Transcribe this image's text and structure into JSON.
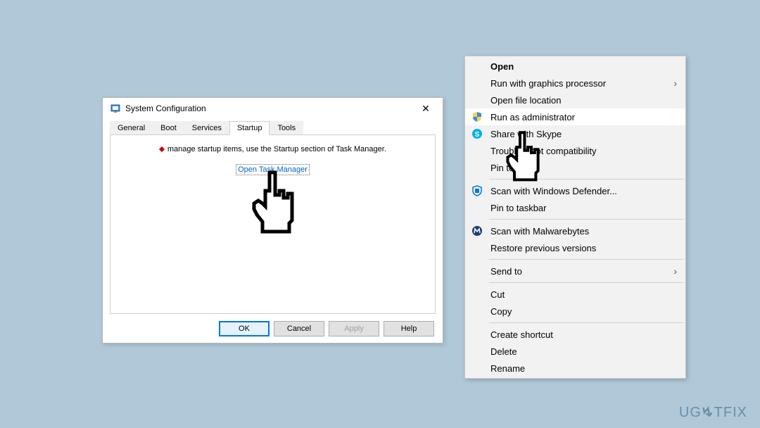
{
  "dialog": {
    "title": "System Configuration",
    "tabs": [
      "General",
      "Boot",
      "Services",
      "Startup",
      "Tools"
    ],
    "active_tab_index": 3,
    "hint": "manage startup items, use the Startup section of Task Manager.",
    "link_label": "Open Task Manager",
    "buttons": {
      "ok": "OK",
      "cancel": "Cancel",
      "apply": "Apply",
      "help": "Help"
    }
  },
  "context_menu": {
    "items": [
      {
        "label": "Open",
        "bold": true
      },
      {
        "label": "Run with graphics processor",
        "submenu": true
      },
      {
        "label": "Open file location"
      },
      {
        "label": "Run as administrator",
        "icon": "shield",
        "highlight": true
      },
      {
        "label": "Share with Skype",
        "icon": "skype"
      },
      {
        "label": "Troubleshoot compatibility"
      },
      {
        "label": "Pin to Start"
      },
      {
        "sep": true
      },
      {
        "label": "Scan with Windows Defender...",
        "icon": "defender"
      },
      {
        "label": "Pin to taskbar"
      },
      {
        "sep": true
      },
      {
        "label": "Scan with Malwarebytes",
        "icon": "malwarebytes"
      },
      {
        "label": "Restore previous versions"
      },
      {
        "sep": true
      },
      {
        "label": "Send to",
        "submenu": true
      },
      {
        "sep": true
      },
      {
        "label": "Cut"
      },
      {
        "label": "Copy"
      },
      {
        "sep": true
      },
      {
        "label": "Create shortcut"
      },
      {
        "label": "Delete"
      },
      {
        "label": "Rename"
      }
    ]
  },
  "watermark": "UG",
  "watermark2": "TFIX"
}
